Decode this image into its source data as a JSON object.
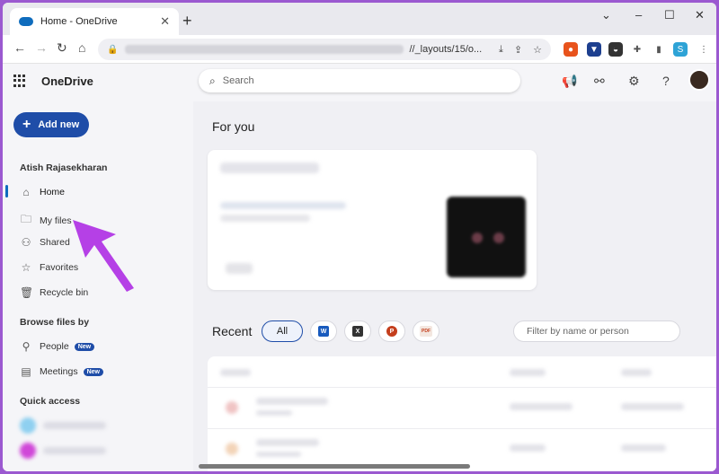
{
  "browser": {
    "tab_title": "Home - OneDrive",
    "tab_close": "✕",
    "new_tab": "+",
    "url_suffix": "//_layouts/15/o...",
    "controls": {
      "minimize": "⌄",
      "restore": "–",
      "maximize": "☐",
      "close": "✕"
    }
  },
  "header": {
    "brand": "OneDrive",
    "search_placeholder": "Search"
  },
  "sidebar": {
    "add_new": "Add new",
    "user_name": "Atish Rajasekharan",
    "items": [
      {
        "label": "Home",
        "icon": "home-icon"
      },
      {
        "label": "My files",
        "icon": "folder-icon"
      },
      {
        "label": "Shared",
        "icon": "people-icon"
      },
      {
        "label": "Favorites",
        "icon": "star-icon"
      },
      {
        "label": "Recycle bin",
        "icon": "trash-icon"
      }
    ],
    "browse_title": "Browse files by",
    "browse_items": [
      {
        "label": "People",
        "badge": "New"
      },
      {
        "label": "Meetings",
        "badge": "New"
      }
    ],
    "quick_access_title": "Quick access"
  },
  "main": {
    "for_you": "For you",
    "recent": "Recent",
    "filters": {
      "all": "All",
      "word": "W",
      "excel": "X",
      "powerpoint": "P",
      "pdf": "PDF"
    },
    "filter_placeholder": "Filter by name or person"
  },
  "colors": {
    "accent": "#1f4da8",
    "brand_blue": "#0f6cbd",
    "arrow": "#b540e6"
  }
}
